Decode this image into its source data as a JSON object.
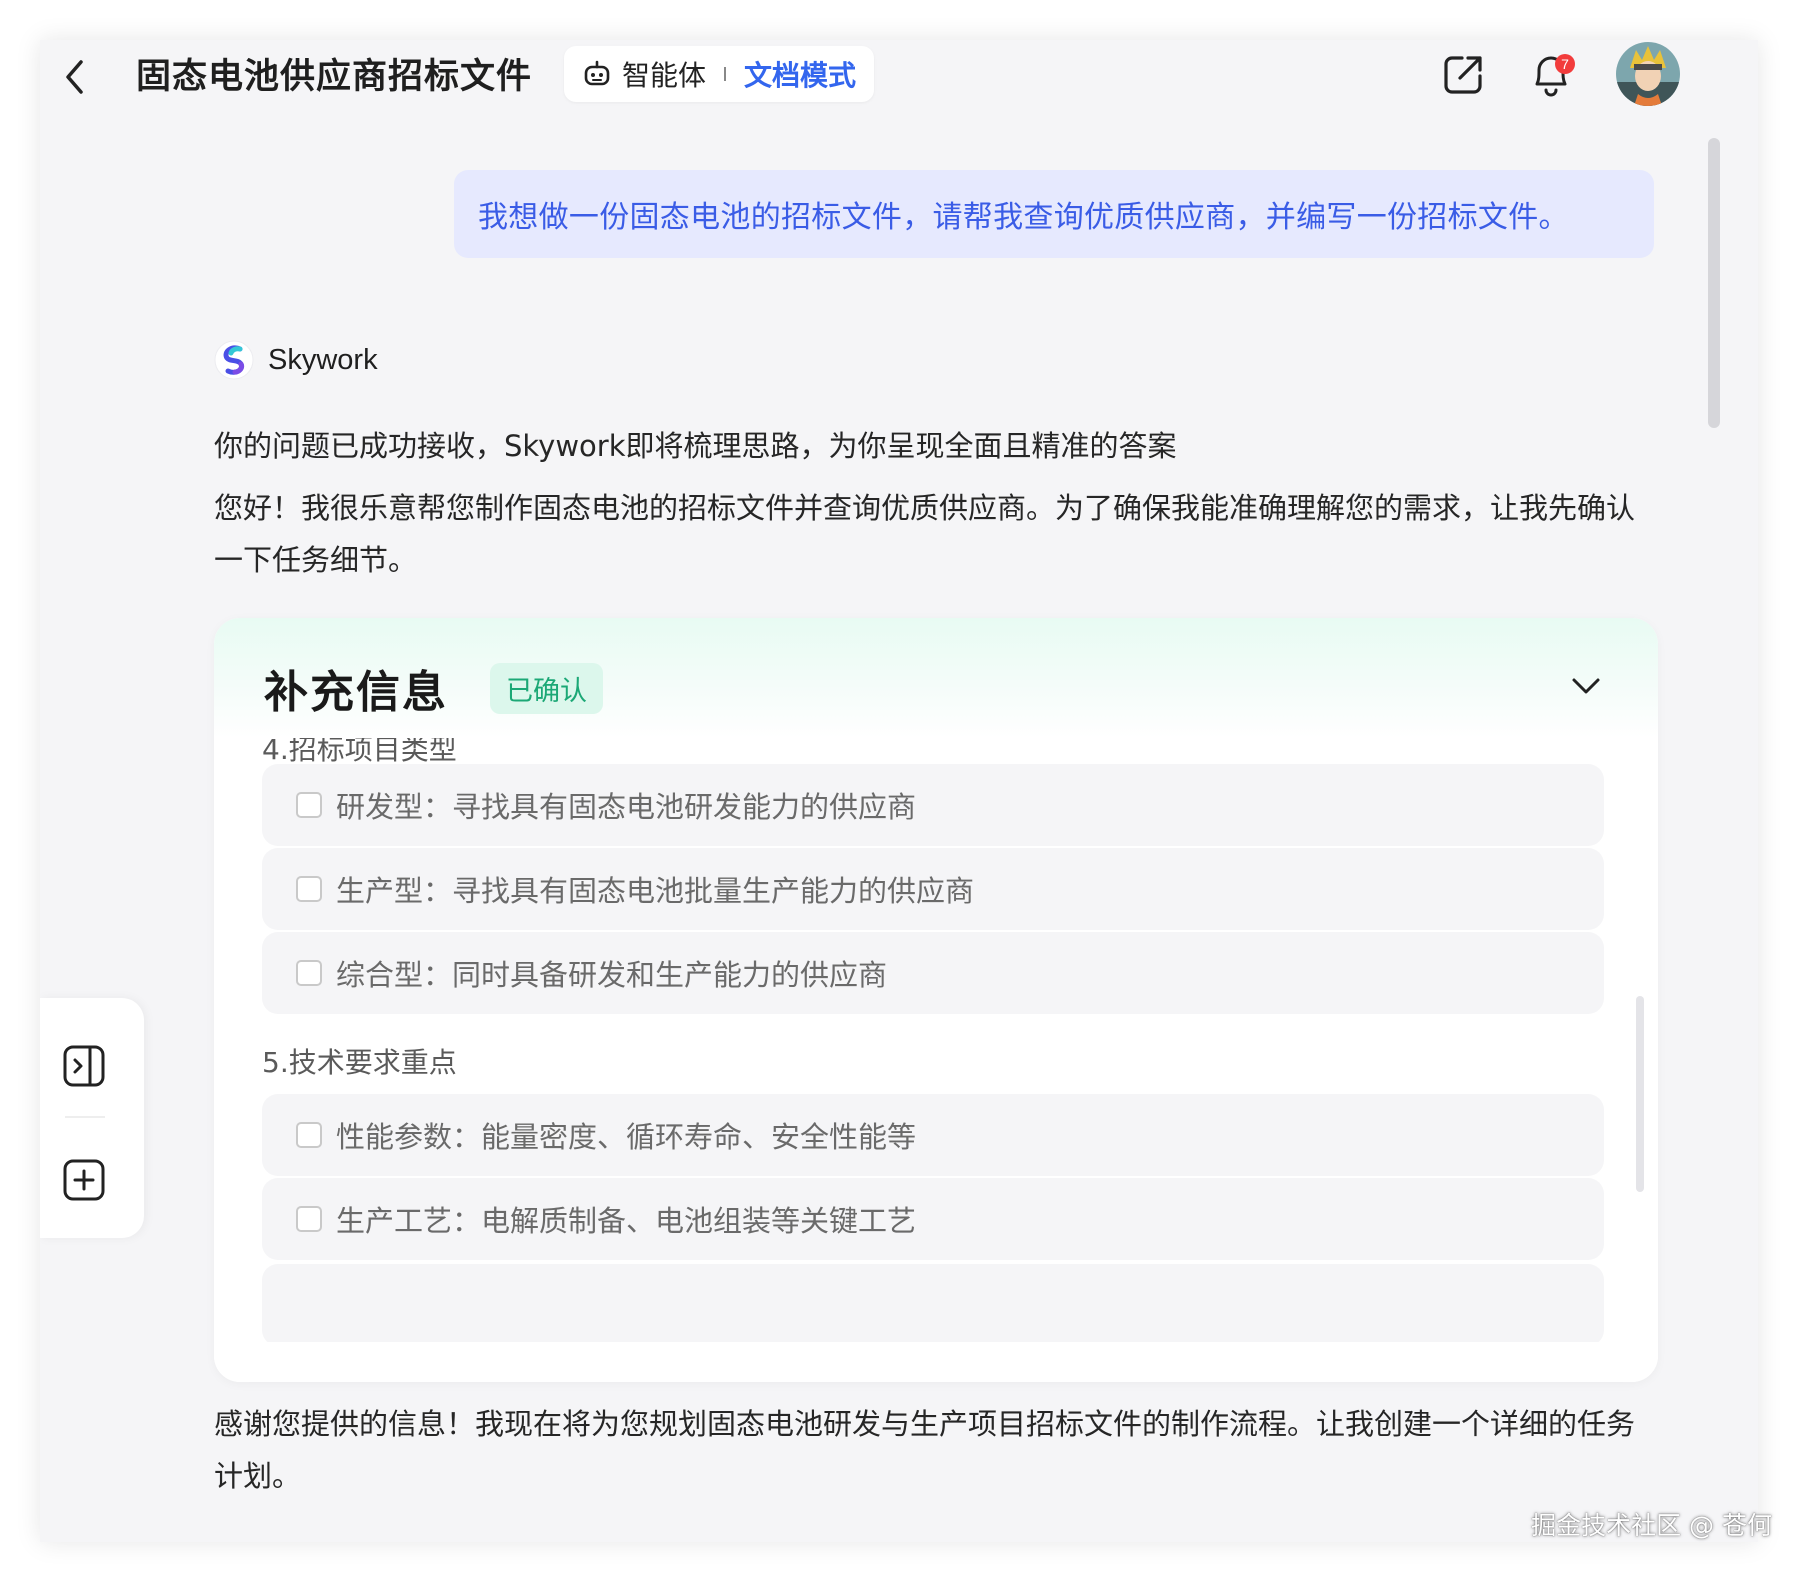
{
  "header": {
    "title": "固态电池供应商招标文件",
    "agent_label": "智能体",
    "mode_label": "文档模式",
    "notification_count": "7"
  },
  "user_message": "我想做一份固态电池的招标文件，请帮我查询优质供应商，并编写一份招标文件。",
  "assistant": {
    "brand_name": "Skywork",
    "messages": [
      "你的问题已成功接收，Skywork即将梳理思路，为你呈现全面且精准的答案",
      "您好！我很乐意帮您制作固态电池的招标文件并查询优质供应商。为了确保我能准确理解您的需求，让我先确认一下任务细节。",
      "感谢您提供的信息！我现在将为您规划固态电池研发与生产项目招标文件的制作流程。让我创建一个详细的任务计划。"
    ]
  },
  "card": {
    "title": "补充信息",
    "status_badge": "已确认",
    "sections": [
      {
        "label": "4.招标项目类型",
        "options": [
          {
            "text": "研发型：寻找具有固态电池研发能力的供应商",
            "checked": false
          },
          {
            "text": "生产型：寻找具有固态电池批量生产能力的供应商",
            "checked": false
          },
          {
            "text": "综合型：同时具备研发和生产能力的供应商",
            "checked": false
          }
        ]
      },
      {
        "label": "5.技术要求重点",
        "options": [
          {
            "text": "性能参数：能量密度、循环寿命、安全性能等",
            "checked": false
          },
          {
            "text": "生产工艺：电解质制备、电池组装等关键工艺",
            "checked": false
          }
        ]
      }
    ]
  },
  "watermark": "掘金技术社区 @ 苍何",
  "icons": {
    "back": "chevron-left-icon",
    "agent": "robot-icon",
    "share": "share-icon",
    "notifications": "bell-icon",
    "collapse": "chevron-down-icon",
    "expand_sidebar": "sidebar-expand-icon",
    "new_chat": "plus-square-icon"
  },
  "colors": {
    "accent_blue": "#3366ee",
    "user_bubble_bg": "#e6e9fe",
    "confirmed_green": "#1ca876",
    "badge_red": "#f23c3c"
  }
}
